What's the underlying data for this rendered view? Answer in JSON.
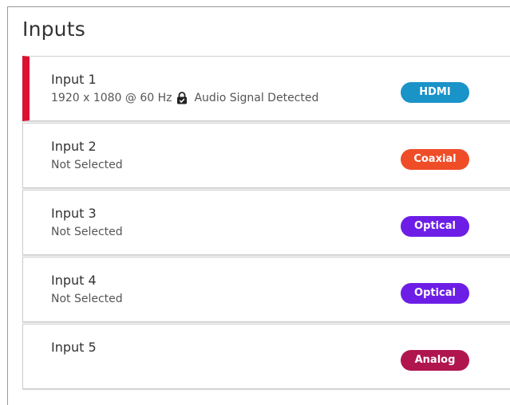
{
  "panel": {
    "title": "Inputs"
  },
  "inputs": [
    {
      "name": "Input 1",
      "status": "1920 x 1080 @ 60 Hz",
      "audio": "Audio Signal Detected",
      "badge": "HDMI",
      "badge_color": "#1a93c9",
      "selected": true
    },
    {
      "name": "Input 2",
      "status": "Not Selected",
      "badge": "Coaxial",
      "badge_color": "#ee4d28"
    },
    {
      "name": "Input 3",
      "status": "Not Selected",
      "badge": "Optical",
      "badge_color": "#6d1ee6"
    },
    {
      "name": "Input 4",
      "status": "Not Selected",
      "badge": "Optical",
      "badge_color": "#6d1ee6"
    },
    {
      "name": "Input 5",
      "status": "",
      "badge": "Analog",
      "badge_color": "#b0154e"
    }
  ],
  "colors": {
    "selected_accent": "#dc1132"
  },
  "icons": {
    "hdcp": "lock-check-icon"
  }
}
